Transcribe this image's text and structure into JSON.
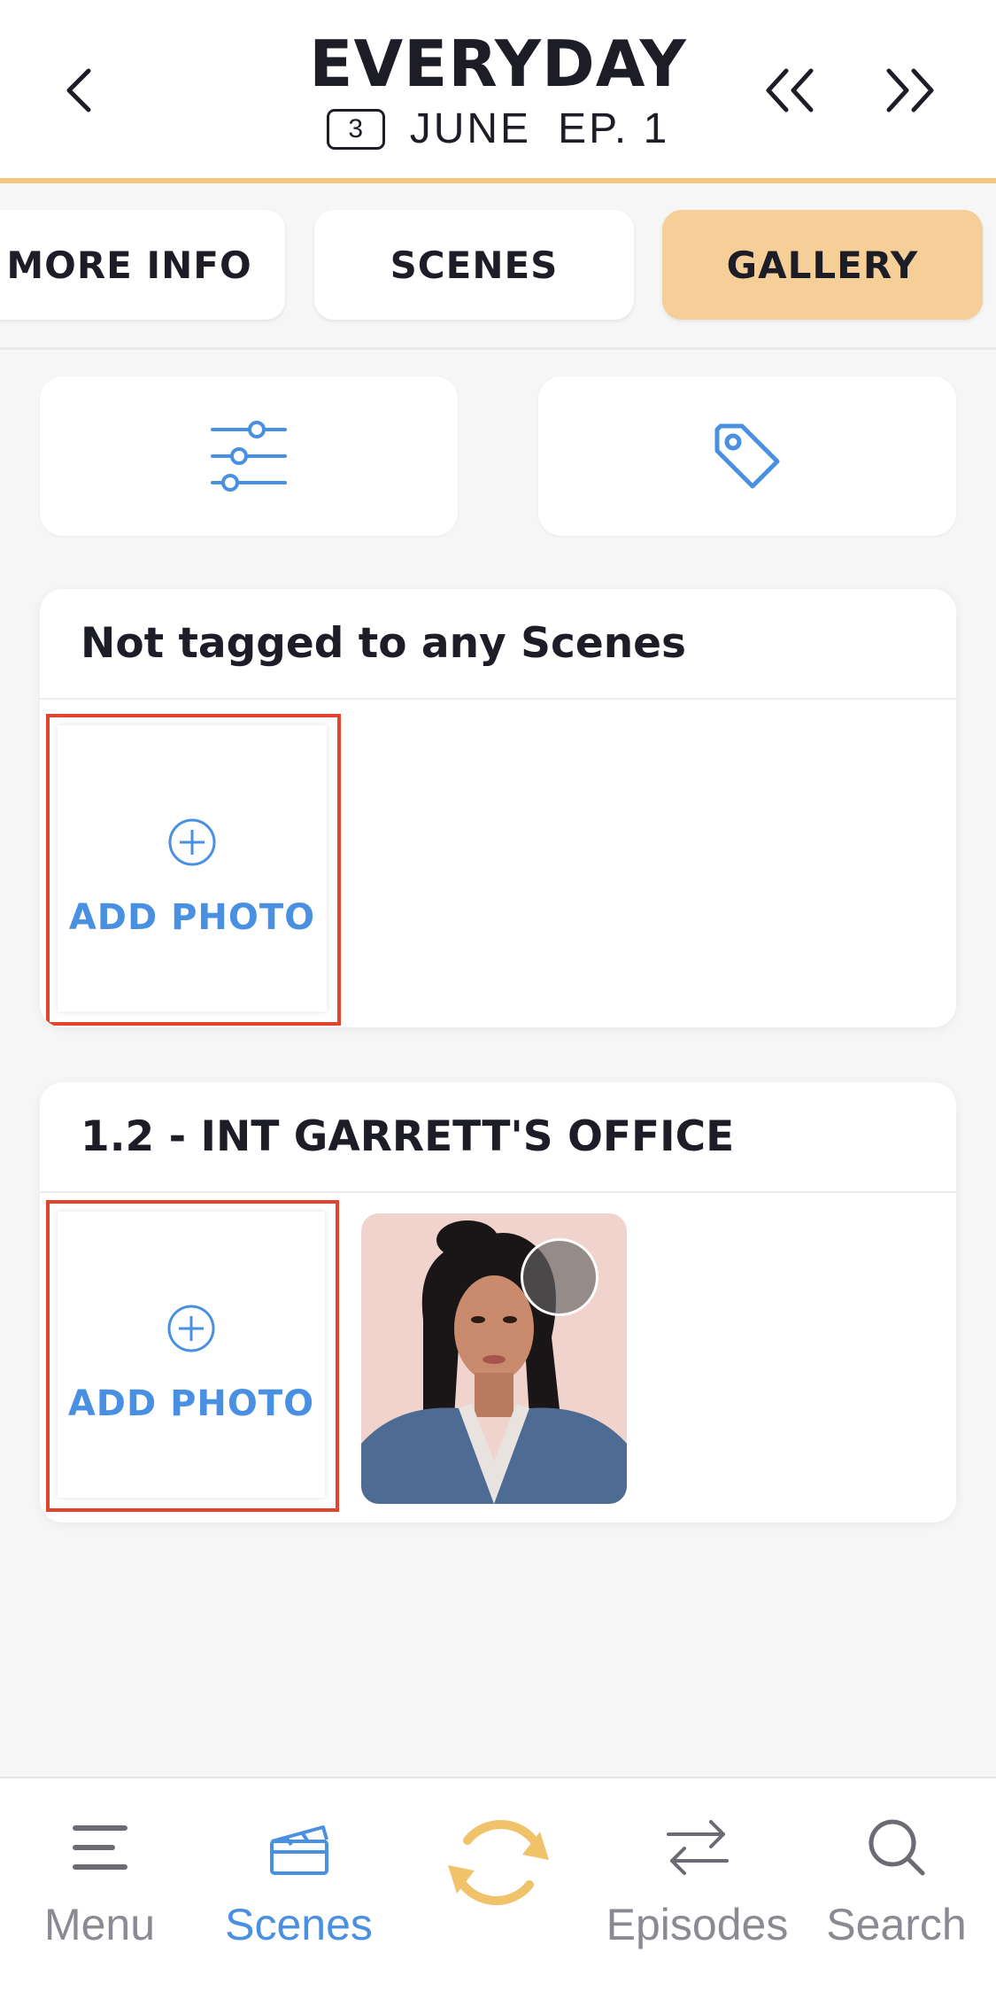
{
  "header": {
    "title": "EVERYDAY",
    "day_badge": "3",
    "month": "JUNE",
    "episode": "EP. 1"
  },
  "tabs": [
    {
      "label": "MORE INFO",
      "active": false
    },
    {
      "label": "SCENES",
      "active": false
    },
    {
      "label": "GALLERY",
      "active": true
    }
  ],
  "tools": {
    "filter_icon": "sliders-icon",
    "tag_icon": "tag-icon"
  },
  "sections": [
    {
      "title": "Not tagged to any Scenes",
      "add_photo_label": "ADD PHOTO"
    },
    {
      "title": "1.2 - INT GARRETT'S OFFICE",
      "add_photo_label": "ADD PHOTO"
    }
  ],
  "bottom_nav": [
    {
      "label": "Menu",
      "icon": "menu-icon"
    },
    {
      "label": "Scenes",
      "icon": "clapperboard-icon",
      "active": true
    },
    {
      "label": "",
      "icon": "sync-icon"
    },
    {
      "label": "Episodes",
      "icon": "swap-icon"
    },
    {
      "label": "Search",
      "icon": "search-icon"
    }
  ],
  "colors": {
    "accent": "#f2c87c",
    "active_tab": "#f6cf98",
    "link_blue": "#4a90e2",
    "highlight_red": "#e2452f"
  }
}
